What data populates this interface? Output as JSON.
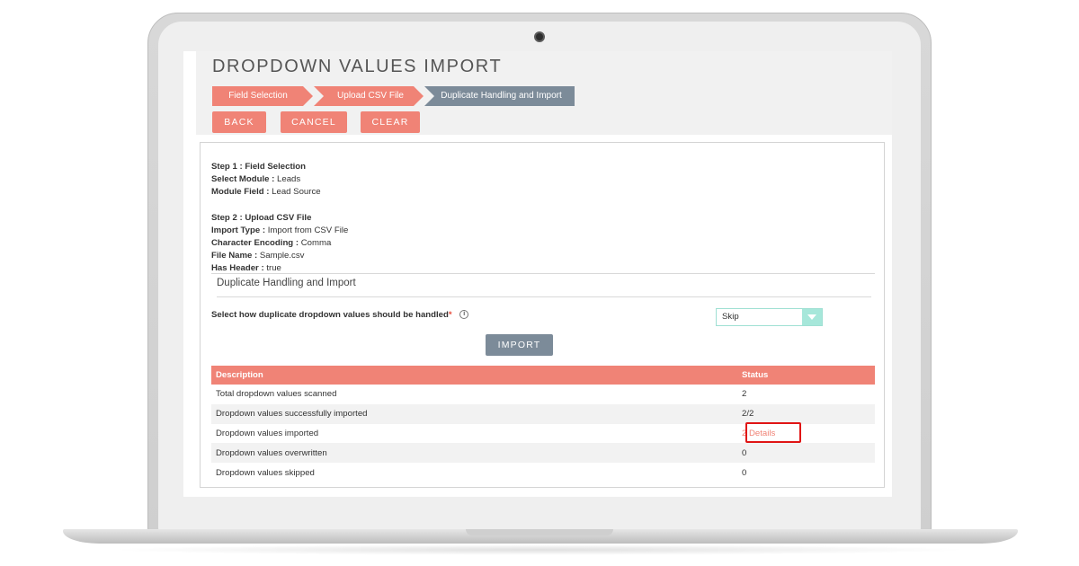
{
  "page": {
    "title": "DROPDOWN VALUES IMPORT"
  },
  "wizard": {
    "steps": [
      {
        "label": "Field Selection",
        "state": "completed"
      },
      {
        "label": "Upload CSV File",
        "state": "completed"
      },
      {
        "label": "Duplicate Handling and Import",
        "state": "active"
      }
    ]
  },
  "actions": {
    "back": "BACK",
    "cancel": "CANCEL",
    "clear": "CLEAR"
  },
  "summary": {
    "step1": {
      "heading": "Step 1 : Field Selection",
      "module_label": "Select Module :",
      "module_value": "Leads",
      "field_label": "Module Field :",
      "field_value": "Lead Source"
    },
    "step2": {
      "heading": "Step 2 : Upload CSV File",
      "import_type_label": "Import Type :",
      "import_type_value": "Import from CSV File",
      "encoding_label": "Character Encoding :",
      "encoding_value": "Comma",
      "file_name_label": "File Name :",
      "file_name_value": "Sample.csv",
      "has_header_label": "Has Header :",
      "has_header_value": "true"
    }
  },
  "duplicate": {
    "section_title": "Duplicate Handling and Import",
    "label": "Select how duplicate dropdown values should be handled",
    "required_mark": "*",
    "info_icon": "i",
    "selected": "Skip",
    "import_button": "IMPORT"
  },
  "results": {
    "headers": {
      "description": "Description",
      "status": "Status"
    },
    "rows": [
      {
        "description": "Total dropdown values scanned",
        "status": "2"
      },
      {
        "description": "Dropdown values successfully imported",
        "status": "2/2"
      },
      {
        "description": "Dropdown values imported",
        "status": "2 Details"
      },
      {
        "description": "Dropdown values overwritten",
        "status": "0"
      },
      {
        "description": "Dropdown values skipped",
        "status": "0"
      }
    ]
  },
  "colors": {
    "accent": "#f08376",
    "slate": "#7c8b99",
    "select_teal": "#a6e7da",
    "highlight_red": "#e01515"
  }
}
